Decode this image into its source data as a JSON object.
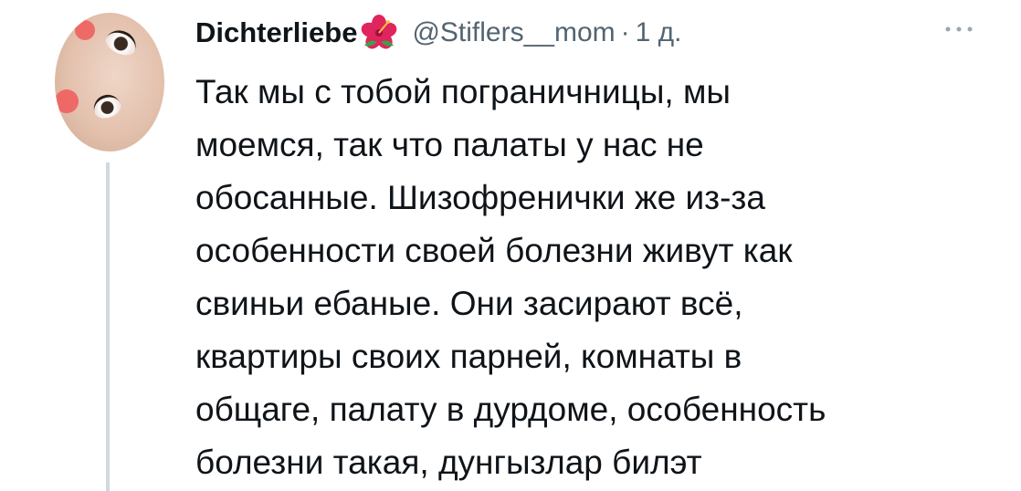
{
  "tweet": {
    "display_name": "Dichterliebe",
    "name_emoji": "hibiscus-icon",
    "handle": "@Stiflers__mom",
    "separator": "·",
    "time": "1 д.",
    "more_icon": "more-horizontal-icon",
    "text_lines": [
      "Так мы с тобой пограничницы, мы",
      "моемся, так что палаты у нас не",
      "обосанные. Шизофренички же из-за",
      "особенности своей болезни живут как",
      "свиньи ебаные. Они засирают всё,",
      "квартиры своих парней, комнаты в",
      "общаге, палату в дурдоме, особенность",
      "болезни такая, дунгызлар билэт"
    ]
  },
  "colors": {
    "text": "#0f1419",
    "secondary": "#536471",
    "thread_line": "#cfd9de",
    "hibiscus": "#e0245e"
  }
}
